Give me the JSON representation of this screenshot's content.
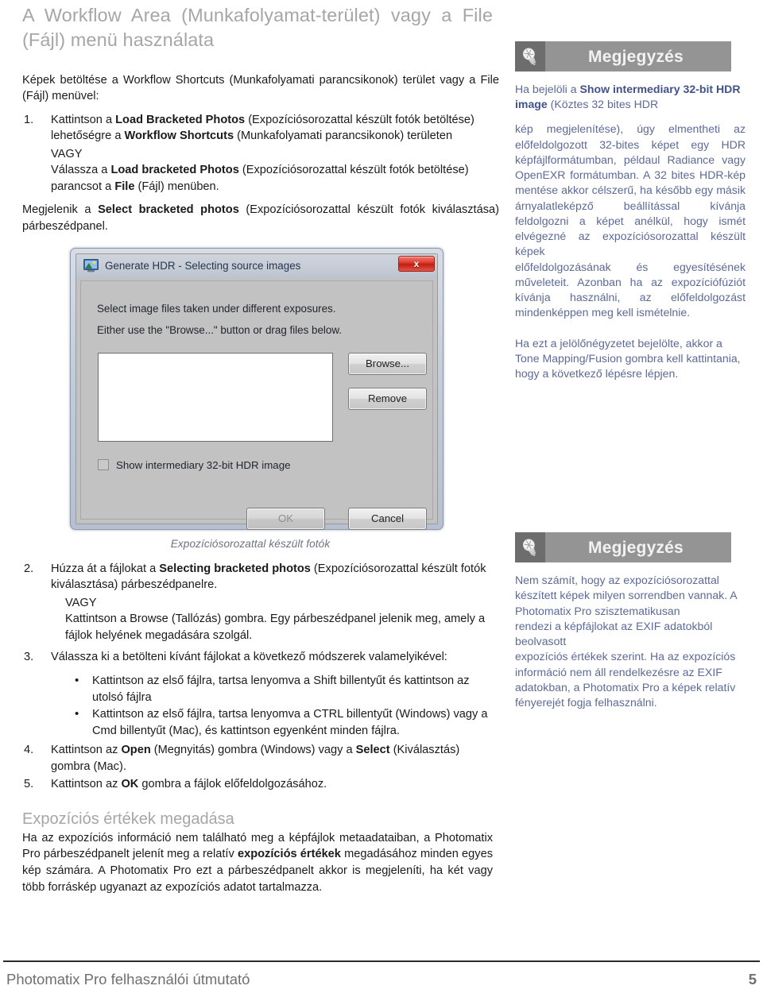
{
  "document": {
    "title": "A Workflow Area (Munkafolyamat-terület) vagy a File (Fájl) menü használata",
    "intro": "Képek betöltése a Workflow Shortcuts (Munkafolyamati parancsikonok) terület vagy a File (Fájl) menüvel:",
    "section_heading": "Expozíciós értékek megadása",
    "section_text_1": "Ha az expozíciós információ nem található meg a képfájlok metaadataiban, a Photomatix Pro párbeszédpanelt jelenít meg a relatív ",
    "section_text_bold": "expozíciós értékek",
    "section_text_2": " megadásához minden egyes kép számára. A Photomatix Pro ezt a párbeszédpanelt akkor is megjeleníti, ha két vagy több forráskép ugyanazt az expozíciós adatot tartalmazza."
  },
  "steps": {
    "s1": {
      "num": "1.",
      "part1": "Kattintson a ",
      "bold1": "Load Bracketed Photos",
      "part2": " (Expozíciósorozattal készült fotók betöltése) lehetőségre a ",
      "bold2": "Workflow Shortcuts",
      "part3": " (Munkafolyamati parancsikonok) területen",
      "or": "VAGY",
      "alt_part1": "Válassza a ",
      "alt_bold1": "Load bracketed Photos",
      "alt_part2": " (Expozíciósorozattal készült fotók betöltése) parancsot a ",
      "alt_bold2": "File",
      "alt_part3": " (Fájl) menüben.",
      "result_part1": "Megjelenik a ",
      "result_bold": "Select bracketed photos",
      "result_part2": " (Expozíciósorozattal készült fotók kiválasztása) párbeszédpanel."
    },
    "s2": {
      "num": "2.",
      "part1": "Húzza át a fájlokat a ",
      "bold1": "Selecting bracketed photos",
      "part2": " (Expozíciósorozattal készült fotók kiválasztása) párbeszédpanelre.",
      "or": "VAGY",
      "alt": "Kattintson a Browse (Tallózás) gombra. Egy párbeszédpanel jelenik meg, amely a fájlok helyének megadására szolgál."
    },
    "s3": {
      "num": "3.",
      "text": "Válassza ki a betölteni kívánt fájlokat a következő módszerek valamelyikével:",
      "bullets": [
        "Kattintson az első fájlra, tartsa lenyomva a Shift billentyűt és kattintson az utolsó fájlra",
        "Kattintson az első fájlra, tartsa lenyomva a CTRL billentyűt (Windows) vagy a Cmd billentyűt (Mac), és kattintson egyenként minden fájlra."
      ]
    },
    "s4": {
      "num": "4.",
      "part1": "Kattintson az ",
      "bold1": "Open",
      "part2": " (Megnyitás) gombra (Windows) vagy a ",
      "bold2": "Select",
      "part3": " (Kiválasztás) gombra (Mac)."
    },
    "s5": {
      "num": "5.",
      "part1": "Kattintson az ",
      "bold1": "OK",
      "part2": " gombra a fájlok előfeldolgozásához."
    }
  },
  "figure": {
    "caption": "Expozíciósorozattal készült fotók",
    "dialog": {
      "title": "Generate HDR - Selecting source images",
      "icon": "hdr-app-icon",
      "close_label": "x",
      "line1": "Select image files taken under different exposures.",
      "line2": "Either use the \"Browse...\" button or drag files below.",
      "browse_label": "Browse...",
      "remove_label": "Remove",
      "checkbox_label": "Show intermediary 32-bit HDR image",
      "checkbox_checked": false,
      "ok_label": "OK",
      "cancel_label": "Cancel"
    }
  },
  "notes": [
    {
      "icon": "lightbulb-icon",
      "title": "Megjegyzés",
      "paragraphs": [
        {
          "runs": [
            {
              "t": "Ha bejelöli a ",
              "b": false
            },
            {
              "t": "Show intermediary 32-bit HDR image",
              "b": true
            },
            {
              "t": " (Köztes 32 bites HDR",
              "b": false
            }
          ]
        },
        {
          "runs": [
            {
              "t": "kép megjelenítése), úgy elmentheti az előfeldolgozott 32-bites képet egy HDR képfájlformátumban, példaul Radiance vagy OpenEXR formátumban. A 32 bites HDR-kép mentése akkor célszerű, ha később egy másik árnyalatleképző beállítással kívánja feldolgozni a képet anélkül, hogy ismét elvégezné az expozíciósorozattal készült képek",
              "b": false
            }
          ]
        },
        {
          "runs": [
            {
              "t": "előfeldolgozásának és egyesítésének műveleteit. Azonban ha az expozíciófúziót kívánja használni, az előfeldolgozást mindenképpen meg kell ismételnie.",
              "b": false
            }
          ]
        },
        {
          "runs": [
            {
              "t": "Ha ezt a jelölőnégyzetet bejelölte, akkor a Tone Mapping/Fusion gombra kell kattintania, hogy a következő lépésre lépjen.",
              "b": false
            }
          ]
        }
      ]
    },
    {
      "icon": "lightbulb-icon",
      "title": "Megjegyzés",
      "paragraphs": [
        {
          "runs": [
            {
              "t": "Nem számít, hogy az expozíciósorozattal készített képek milyen sorrendben vannak. A Photomatix Pro szisztematikusan",
              "b": false
            }
          ]
        },
        {
          "runs": [
            {
              "t": "rendezi a képfájlokat az EXIF adatokból beolvasott",
              "b": false
            }
          ]
        },
        {
          "runs": [
            {
              "t": "expozíciós értékek szerint. Ha az expozíciós információ nem áll rendelkezésre az EXIF adatokban, a Photomatix Pro a képek relatív fényerejét fogja felhasználni.",
              "b": false
            }
          ]
        }
      ]
    }
  ],
  "footer": {
    "title": "Photomatix Pro felhasználói útmutató",
    "page": "5"
  },
  "colors": {
    "heading_gray": "#a6a6a6",
    "note_header_bg": "#949494",
    "note_icon_bg": "#6d6d6d",
    "note_text": "#5d6a96",
    "note_bold": "#41518a",
    "caption": "#6b7280",
    "footer": "#6f6f6f",
    "close_button_red": "#c31f12"
  }
}
